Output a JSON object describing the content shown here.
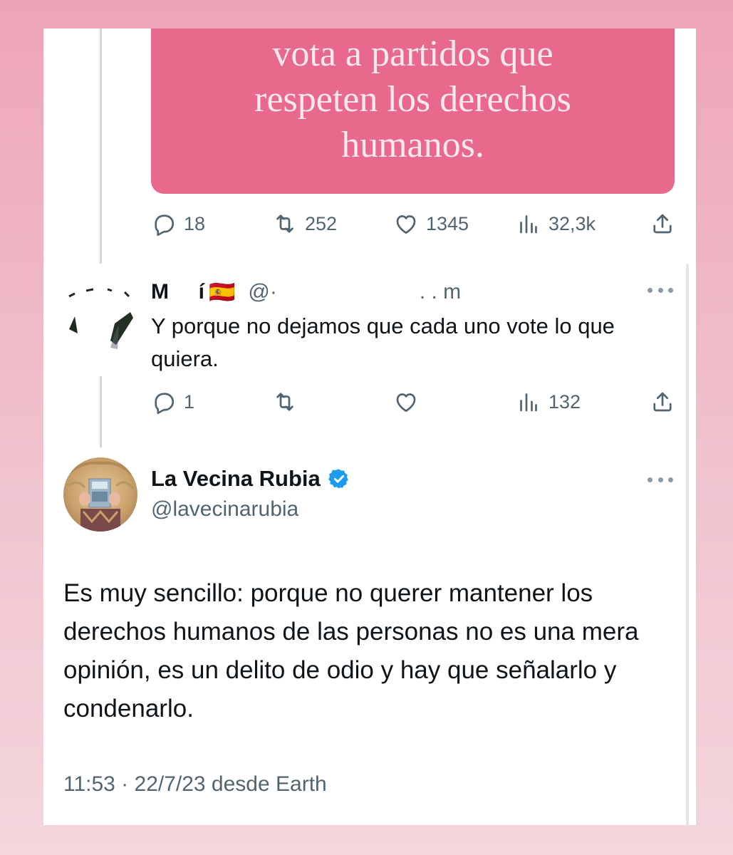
{
  "media": {
    "text": "vota a partidos que\nrespeten los derechos\nhumanos."
  },
  "first_tweet_actions": {
    "replies": "18",
    "retweets": "252",
    "likes": "1345",
    "views": "32,3k"
  },
  "reply_tweet": {
    "name_visible": "M     í",
    "flag": "🇪🇸",
    "handle_visible": "@·                        . . m",
    "text": "Y porque no dejamos que cada uno vote lo que quiera.",
    "actions": {
      "replies": "1",
      "retweets": "",
      "likes": "",
      "views": "132"
    }
  },
  "main_tweet": {
    "name": "La Vecina Rubia",
    "verified": true,
    "handle": "@lavecinarubia",
    "text": "Es muy sencillo: porque no querer mantener los derechos humanos de las personas no es una mera opinión, es un delito de odio y hay que señalarlo y condenarlo.",
    "timestamp": "11:53 · 22/7/23 desde Earth"
  },
  "icons": {
    "reply": "reply-bubble-icon",
    "retweet": "retweet-arrows-icon",
    "like": "heart-icon",
    "views": "bar-chart-icon",
    "share": "share-upload-icon",
    "more": "more-dots-icon",
    "verified": "verified-badge-icon"
  },
  "colors": {
    "media_background": "#e8698b",
    "secondary_text": "#536471",
    "primary_text": "#0f1419",
    "verified_blue": "#1d9bf0",
    "page_background": "#eea4b7"
  }
}
